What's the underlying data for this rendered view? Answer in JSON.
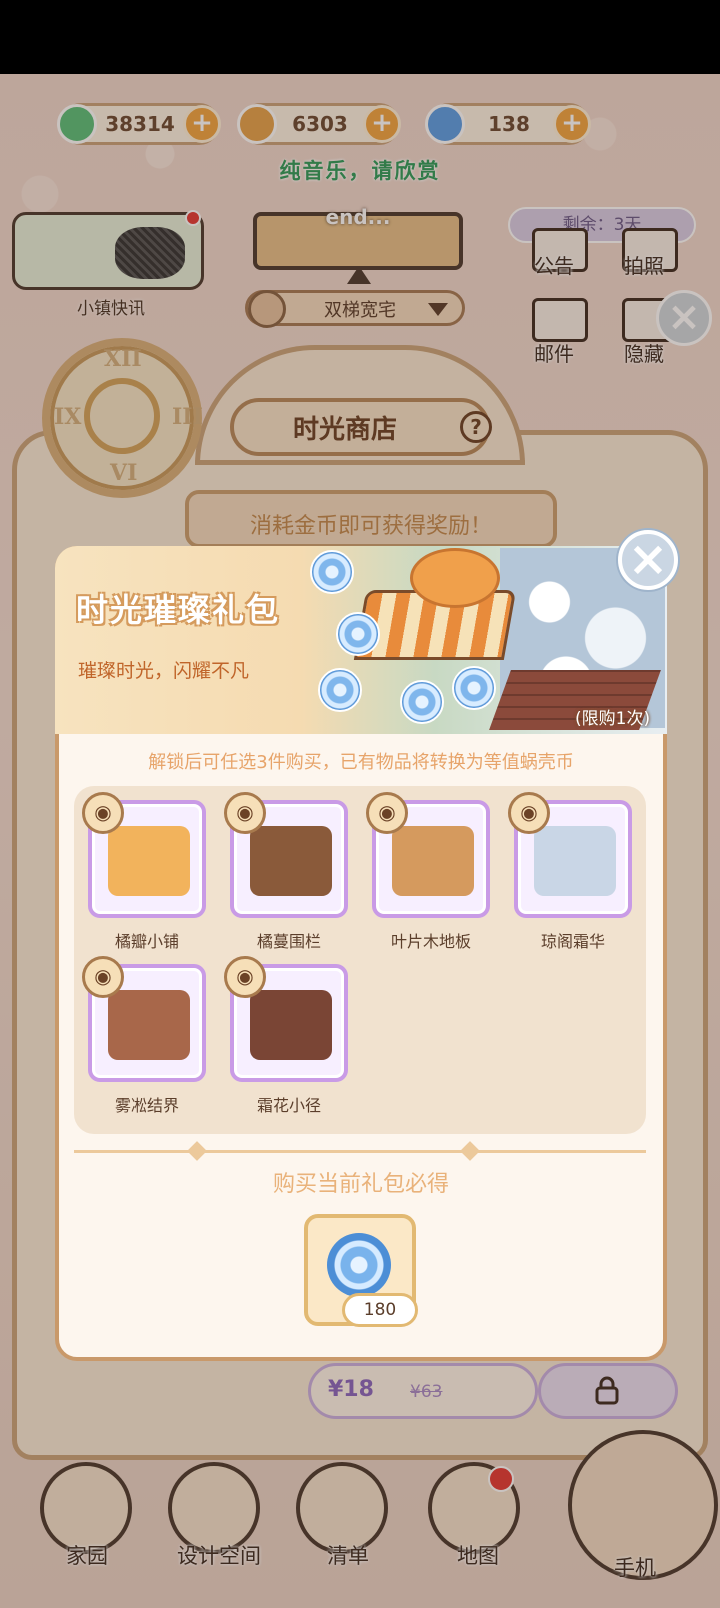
{
  "currencies": [
    {
      "name": "clover",
      "value": "38314",
      "color": "#5bbf7a"
    },
    {
      "name": "shell",
      "value": "6303",
      "color": "#e5a24b"
    },
    {
      "name": "swirl",
      "value": "138",
      "color": "#5b9ee6"
    }
  ],
  "music_note": "纯音乐，请欣赏",
  "news": {
    "label": "小镇快讯"
  },
  "notice": {
    "text": "end..."
  },
  "house_select": {
    "value": "双梯宽宅"
  },
  "right_menu": {
    "remain": "剩余：3天",
    "items": [
      "公告",
      "拍照",
      "邮件",
      "隐藏"
    ]
  },
  "shop": {
    "title": "时光商店",
    "help": "?",
    "reward_banner": "消耗金币即可获得奖励！",
    "clock_numerals": [
      "XII",
      "III",
      "VI",
      "IX"
    ],
    "price_now": "¥18",
    "price_old": "¥63"
  },
  "bottom_nav": [
    {
      "label": "家园"
    },
    {
      "label": "设计空间"
    },
    {
      "label": "清单"
    },
    {
      "label": "地图"
    },
    {
      "label": "手机"
    }
  ],
  "modal": {
    "title": "时光璀璨礼包",
    "subtitle": "璀璨时光，闪耀不凡",
    "limit": "(限购1次)",
    "close": "×",
    "unlock_info": "解锁后可任选3件购买，已有物品将转换为等值蜗壳币",
    "items": [
      {
        "label": "橘瓣小铺",
        "icon": "shop-stall-icon",
        "color": "#f2b35c"
      },
      {
        "label": "橘蔓围栏",
        "icon": "vine-fence-icon",
        "color": "#8a5a3a"
      },
      {
        "label": "叶片木地板",
        "icon": "wood-floor-icon",
        "color": "#d59a5e"
      },
      {
        "label": "琼阁霜华",
        "icon": "frost-tree-icon",
        "color": "#c9d6e6"
      },
      {
        "label": "雾凇结界",
        "icon": "rime-fence-icon",
        "color": "#a8674a"
      },
      {
        "label": "霜花小径",
        "icon": "frost-path-icon",
        "color": "#7a4535"
      }
    ],
    "must_get": "购买当前礼包必得",
    "reward": {
      "count": "180",
      "icon": "swirl-coin-icon"
    }
  }
}
